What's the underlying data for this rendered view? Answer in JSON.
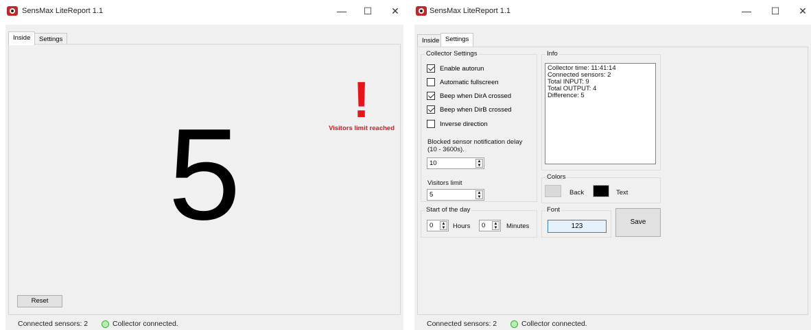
{
  "left_window": {
    "title": "SensMax LiteReport 1.1",
    "controls": {
      "minimize": "—",
      "maximize": "☐",
      "close": "✕"
    },
    "tabs": [
      {
        "label": "Inside",
        "active": true
      },
      {
        "label": "Settings",
        "active": false
      }
    ],
    "count": "5",
    "alert_mark": "!",
    "alert_text": "Visitors limit reached",
    "reset_label": "Reset",
    "status": {
      "sensors": "Connected sensors: 2",
      "collector": "Collector connected."
    }
  },
  "right_window": {
    "title": "SensMax LiteReport 1.1",
    "controls": {
      "minimize": "—",
      "maximize": "☐",
      "close": "✕"
    },
    "tabs": [
      {
        "label": "Inside",
        "active": false
      },
      {
        "label": "Settings",
        "active": true
      }
    ],
    "collector_settings": {
      "title": "Collector Settings",
      "checkboxes": [
        {
          "label": "Enable autorun",
          "checked": true
        },
        {
          "label": "Automatic fullscreen",
          "checked": false
        },
        {
          "label": "Beep when DirA crossed",
          "checked": true
        },
        {
          "label": "Beep when DirB crossed",
          "checked": true
        },
        {
          "label": "Inverse direction",
          "checked": false
        }
      ],
      "blocked_label": "Blocked sensor notification delay (10 - 3600s).",
      "blocked_value": "10",
      "visitors_label": "Visitors limit",
      "visitors_value": "5"
    },
    "info": {
      "title": "Info",
      "lines": [
        "Collector time: 11:41:14",
        "Connected sensors: 2",
        "Total INPUT: 9",
        "Total OUTPUT: 4",
        "Difference: 5"
      ]
    },
    "colors": {
      "title": "Colors",
      "back_label": "Back",
      "text_label": "Text",
      "back_color": "#d9d9d9",
      "text_color": "#000000"
    },
    "start_of_day": {
      "title": "Start of the day",
      "hours_value": "0",
      "hours_label": "Hours",
      "minutes_value": "0",
      "minutes_label": "Minutes"
    },
    "font": {
      "title": "Font",
      "sample": "123"
    },
    "save_label": "Save",
    "status": {
      "sensors": "Connected sensors: 2",
      "collector": "Collector connected."
    }
  },
  "colors": {
    "alert": "#e8141a",
    "status_ok": "#3fae3a"
  },
  "icons": [
    "app-logo-icon",
    "minimize-icon",
    "maximize-icon",
    "close-icon",
    "status-ok-icon",
    "spin-arrows-icon",
    "checkbox-check-icon"
  ]
}
